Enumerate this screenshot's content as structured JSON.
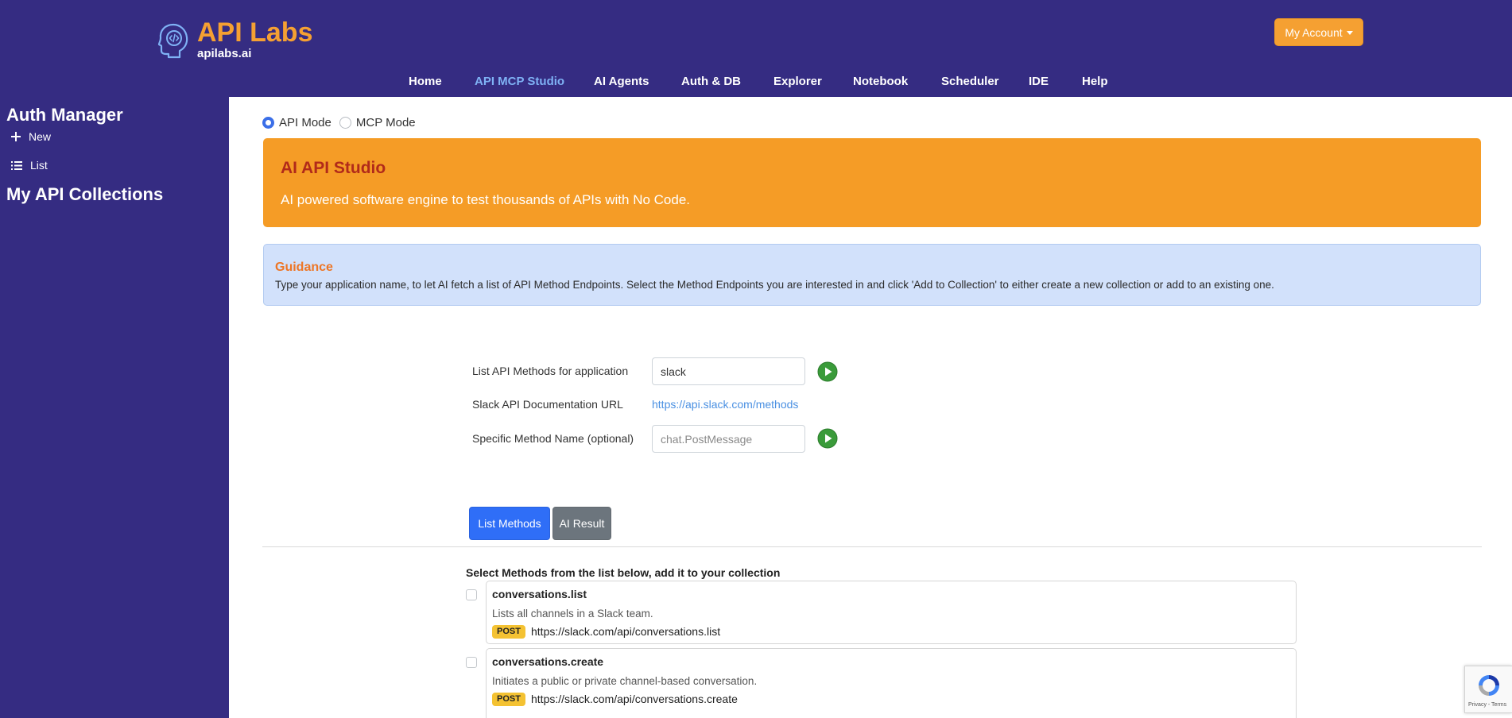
{
  "header": {
    "logo_icon": "head-code-icon",
    "brand_title": "API Labs",
    "brand_subtitle": "apilabs.ai",
    "account_button": "My Account"
  },
  "nav": {
    "items": [
      "Home",
      "API MCP Studio",
      "AI Agents",
      "Auth & DB",
      "Explorer",
      "Notebook",
      "Scheduler",
      "IDE",
      "Help"
    ],
    "active": "API MCP Studio"
  },
  "sidebar": {
    "auth_title": "Auth Manager",
    "new_label": "New",
    "list_label": "List",
    "collections_title": "My API Collections"
  },
  "modes": {
    "api_mode": "API Mode",
    "mcp_mode": "MCP Mode",
    "selected": "API Mode"
  },
  "hero": {
    "title": "AI API Studio",
    "subtitle": "AI powered software engine to test thousands of APIs with No Code."
  },
  "guidance": {
    "title": "Guidance",
    "text": "Type your application name, to let AI fetch a list of API Method Endpoints. Select the Method Endpoints you are interested in and click 'Add to Collection' to either create a new collection or add to an existing one."
  },
  "form": {
    "app_label": "List API Methods for application",
    "app_value": "slack",
    "doc_label": "Slack API Documentation URL",
    "doc_url": "https://api.slack.com/methods",
    "method_label": "Specific Method Name (optional)",
    "method_placeholder": "chat.PostMessage"
  },
  "tabs": {
    "list_methods": "List Methods",
    "ai_result": "AI Result"
  },
  "methods": {
    "heading": "Select Methods from the list below, add it to your collection",
    "items": [
      {
        "name": "conversations.list",
        "description": "Lists all channels in a Slack team.",
        "http_method": "POST",
        "url": "https://slack.com/api/conversations.list"
      },
      {
        "name": "conversations.create",
        "description": "Initiates a public or private channel-based conversation.",
        "http_method": "POST",
        "url": "https://slack.com/api/conversations.create"
      }
    ]
  },
  "recaptcha": {
    "terms": "Privacy - Terms"
  },
  "colors": {
    "brand_purple": "#352c82",
    "brand_orange": "#f5a032",
    "hero_orange": "#f59c26",
    "hero_title_red": "#b12a1a",
    "nav_active": "#7fb2f5",
    "primary_blue": "#2f6ef7",
    "secondary_gray": "#6c757d",
    "guidance_bg": "#d2e1fb",
    "guidance_title": "#ed7626",
    "badge_yellow": "#f4c232",
    "play_green": "#3a9b3a"
  }
}
